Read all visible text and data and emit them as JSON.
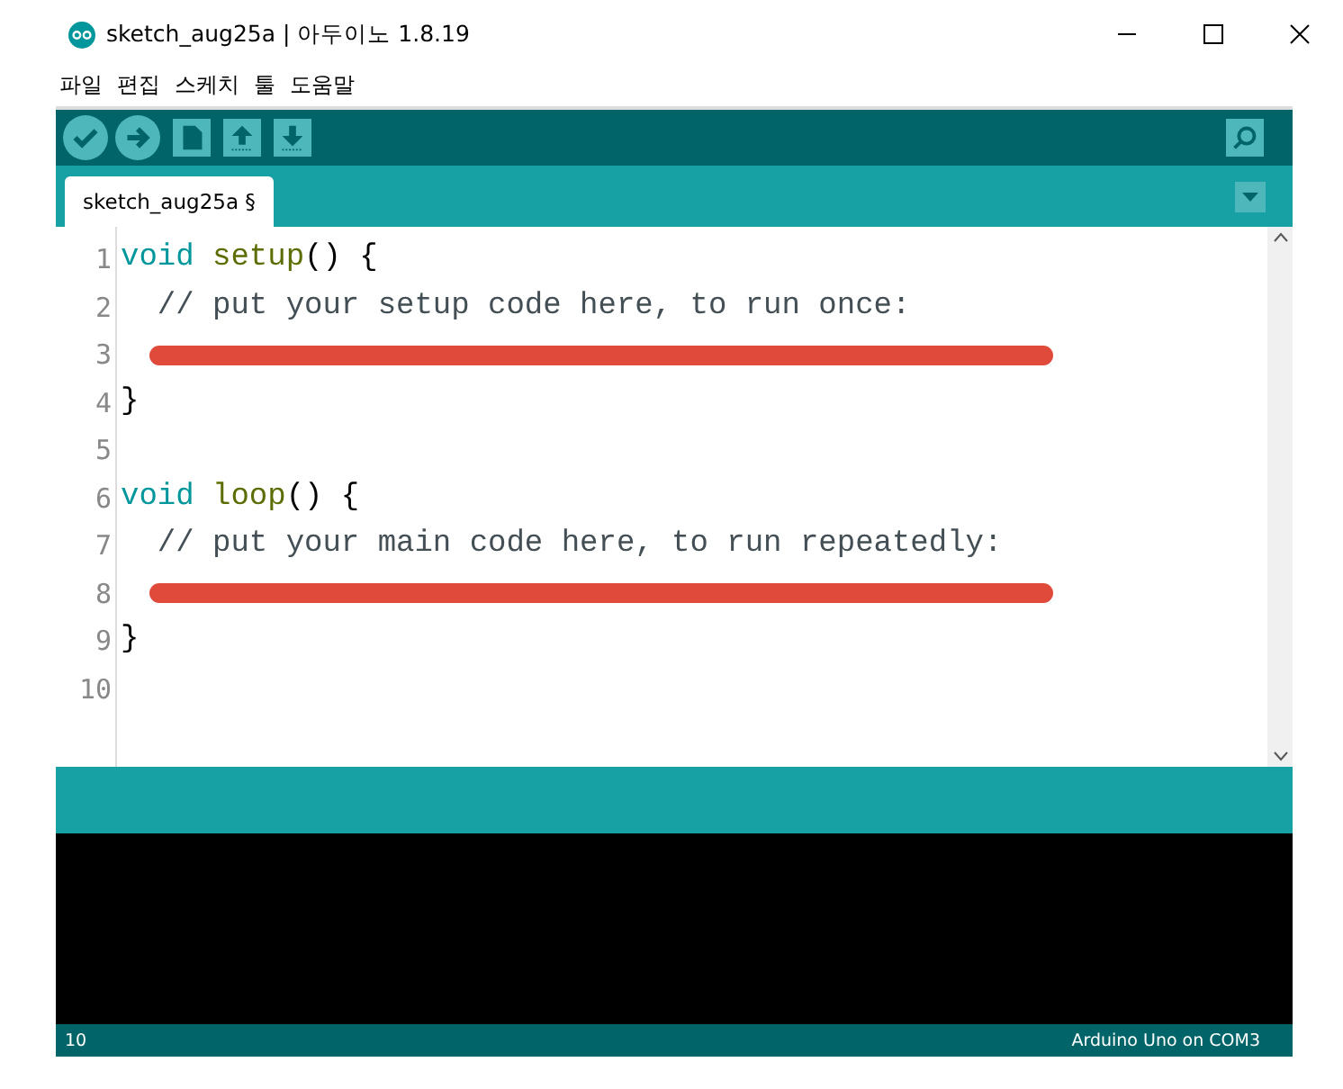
{
  "window": {
    "title": "sketch_aug25a | 아두이노 1.8.19"
  },
  "menu": [
    "파일",
    "편집",
    "스케치",
    "툴",
    "도움말"
  ],
  "toolbar": [
    {
      "kind": "verify"
    },
    {
      "kind": "upload"
    },
    {
      "kind": "new"
    },
    {
      "kind": "open"
    },
    {
      "kind": "save"
    }
  ],
  "tabs": [
    {
      "label": "sketch_aug25a §",
      "selected": true
    }
  ],
  "editor": {
    "lines": [
      {
        "number": "1",
        "tokens": [
          {
            "kind": "type",
            "text": "void"
          },
          {
            "kind": "func",
            "text": " setup"
          },
          {
            "kind": "plain",
            "text": "() {"
          }
        ]
      },
      {
        "number": "2",
        "tokens": [
          {
            "kind": "comment",
            "text": "  // put your setup code here, to run once:"
          }
        ]
      },
      {
        "number": "3",
        "underlined": true
      },
      {
        "number": "4",
        "tokens": [
          {
            "kind": "plain",
            "text": "}"
          }
        ]
      },
      {
        "number": "5"
      },
      {
        "number": "6",
        "tokens": [
          {
            "kind": "type",
            "text": "void"
          },
          {
            "kind": "func",
            "text": " loop"
          },
          {
            "kind": "plain",
            "text": "() {"
          }
        ]
      },
      {
        "number": "7",
        "tokens": [
          {
            "kind": "comment",
            "text": "  // put your main code here, to run repeatedly:"
          }
        ]
      },
      {
        "number": "8",
        "underlined": true
      },
      {
        "number": "9",
        "tokens": [
          {
            "kind": "plain",
            "text": "}"
          }
        ]
      },
      {
        "number": "10"
      }
    ]
  },
  "status_bar": {
    "line": "10",
    "board": "Arduino Uno on COM3"
  }
}
